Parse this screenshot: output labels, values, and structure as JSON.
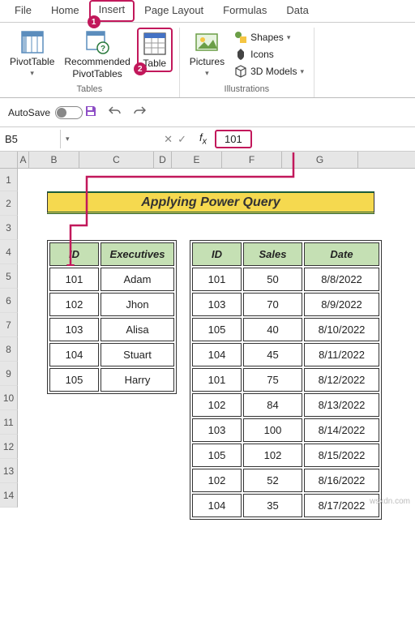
{
  "tabs": [
    "File",
    "Home",
    "Insert",
    "Page Layout",
    "Formulas",
    "Data"
  ],
  "active_tab": "Insert",
  "annot": {
    "tab_num": "1",
    "table_num": "2"
  },
  "ribbon": {
    "tables": {
      "pivot": "PivotTable",
      "recommended_l1": "Recommended",
      "recommended_l2": "PivotTables",
      "table": "Table",
      "group": "Tables"
    },
    "illus": {
      "pictures": "Pictures",
      "shapes": "Shapes",
      "icons": "Icons",
      "models": "3D Models",
      "group": "Illustrations"
    }
  },
  "qat": {
    "autosave": "AutoSave",
    "off": "Off"
  },
  "namebox": "B5",
  "formula_value": "101",
  "cols": [
    "A",
    "B",
    "C",
    "D",
    "E",
    "F",
    "G"
  ],
  "row_nums": [
    "1",
    "2",
    "3",
    "4",
    "5",
    "6",
    "7",
    "8",
    "9",
    "10",
    "11",
    "12",
    "13",
    "14"
  ],
  "title": "Applying Power Query",
  "table1": {
    "headers": [
      "ID",
      "Executives"
    ],
    "rows": [
      [
        "101",
        "Adam"
      ],
      [
        "102",
        "Jhon"
      ],
      [
        "103",
        "Alisa"
      ],
      [
        "104",
        "Stuart"
      ],
      [
        "105",
        "Harry"
      ]
    ]
  },
  "table2": {
    "headers": [
      "ID",
      "Sales",
      "Date"
    ],
    "rows": [
      [
        "101",
        "50",
        "8/8/2022"
      ],
      [
        "103",
        "70",
        "8/9/2022"
      ],
      [
        "105",
        "40",
        "8/10/2022"
      ],
      [
        "104",
        "45",
        "8/11/2022"
      ],
      [
        "101",
        "75",
        "8/12/2022"
      ],
      [
        "102",
        "84",
        "8/13/2022"
      ],
      [
        "103",
        "100",
        "8/14/2022"
      ],
      [
        "105",
        "102",
        "8/15/2022"
      ],
      [
        "102",
        "52",
        "8/16/2022"
      ],
      [
        "104",
        "35",
        "8/17/2022"
      ]
    ]
  },
  "watermark": "wsxdn.com"
}
